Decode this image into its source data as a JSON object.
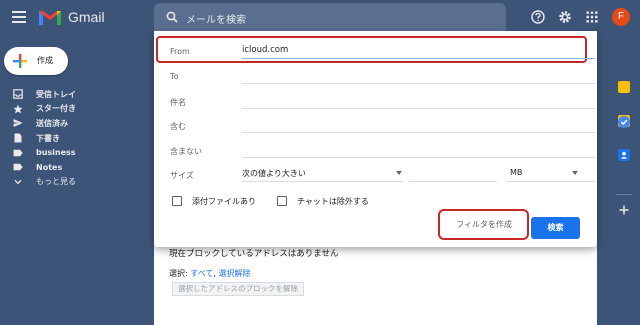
{
  "app": {
    "name": "Gmail",
    "avatar_letter": "F"
  },
  "search": {
    "placeholder": "メールを検索"
  },
  "sidebar": {
    "compose_label": "作成",
    "items": [
      {
        "label": "受信トレイ",
        "icon": "inbox-icon"
      },
      {
        "label": "スター付き",
        "icon": "star-icon"
      },
      {
        "label": "送信済み",
        "icon": "send-icon"
      },
      {
        "label": "下書き",
        "icon": "draft-icon"
      },
      {
        "label": "business",
        "icon": "label-icon"
      },
      {
        "label": "Notes",
        "icon": "label-icon"
      },
      {
        "label": "もっと見る",
        "icon": "chevron-down-icon"
      }
    ]
  },
  "dialog": {
    "from_label": "From",
    "from_value": "icloud.com",
    "to_label": "To",
    "subject_label": "件名",
    "has_words_label": "含む",
    "not_has_label": "含まない",
    "size_label": "サイズ",
    "size_operator": "次の値より大きい",
    "size_unit": "MB",
    "has_attachment_label": "添付ファイルあり",
    "exclude_chats_label": "チャットは除外する",
    "create_filter_label": "フィルタを作成",
    "search_button_label": "検索"
  },
  "background": {
    "blocked_text": "現在ブロックしているアドレスはありません",
    "select_prefix": "選択:",
    "select_all": "すべて",
    "select_none": "選択解除",
    "unblock_button": "選択したアドレスのブロックを解除"
  },
  "colors": {
    "header_bg": "#3d5479",
    "accent_blue": "#1a73e8",
    "highlight_red": "#c62828",
    "avatar_bg": "#e64a19"
  }
}
